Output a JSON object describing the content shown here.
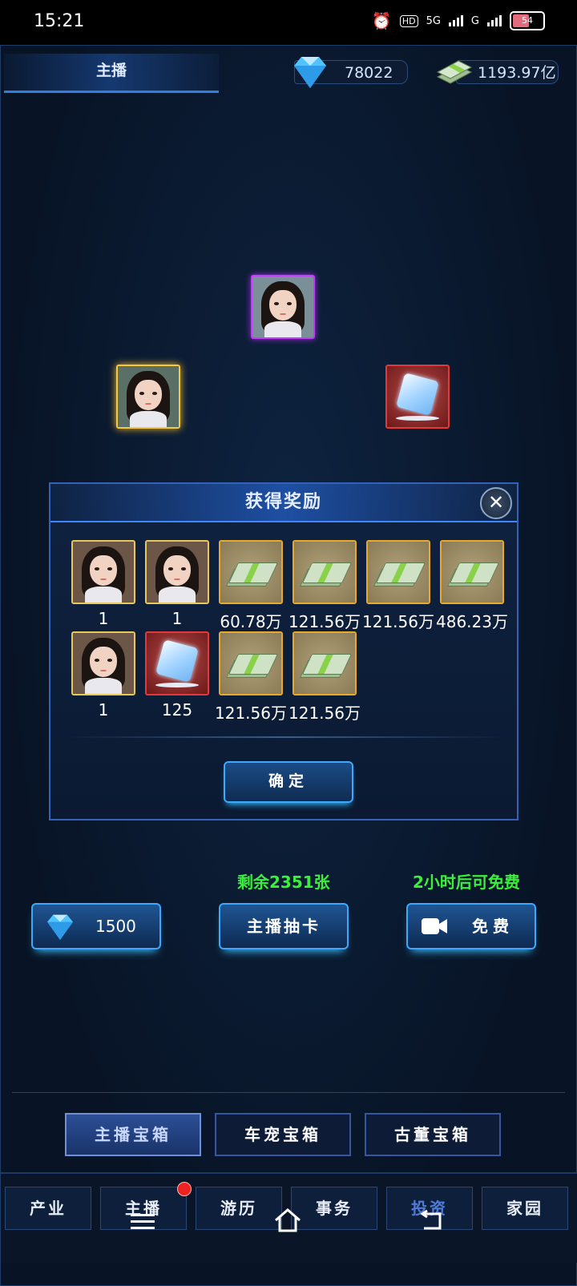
{
  "status": {
    "time": "15:21",
    "battery": "54",
    "net1": "5G",
    "net2": "G"
  },
  "header": {
    "title": "主播",
    "diamonds": "78022",
    "cash": "1193.97亿"
  },
  "dialog": {
    "title": "获得奖励",
    "close": "✕",
    "rewards": [
      {
        "type": "portrait",
        "qty": "1"
      },
      {
        "type": "portrait",
        "qty": "1"
      },
      {
        "type": "cash",
        "qty": "60.78万"
      },
      {
        "type": "cash",
        "qty": "121.56万"
      },
      {
        "type": "cash",
        "qty": "121.56万"
      },
      {
        "type": "cash",
        "qty": "486.23万"
      },
      {
        "type": "portrait",
        "qty": "1"
      },
      {
        "type": "ice",
        "qty": "125"
      },
      {
        "type": "cash",
        "qty": "121.56万"
      },
      {
        "type": "cash",
        "qty": "121.56万"
      }
    ],
    "confirm": "确定"
  },
  "draw": {
    "remaining": "剩余2351张",
    "free_timer": "2小时后可免费",
    "diamond_cost": "1500",
    "draw_label": "主播抽卡",
    "free_label": "免费"
  },
  "chest_tabs": [
    "主播宝箱",
    "车宠宝箱",
    "古董宝箱"
  ],
  "nav": [
    "产业",
    "主播",
    "游历",
    "事务",
    "投资",
    "家园"
  ],
  "colors": {
    "accent": "#3ea8ff",
    "green": "#3af03a",
    "gold": "#e9a92c"
  }
}
